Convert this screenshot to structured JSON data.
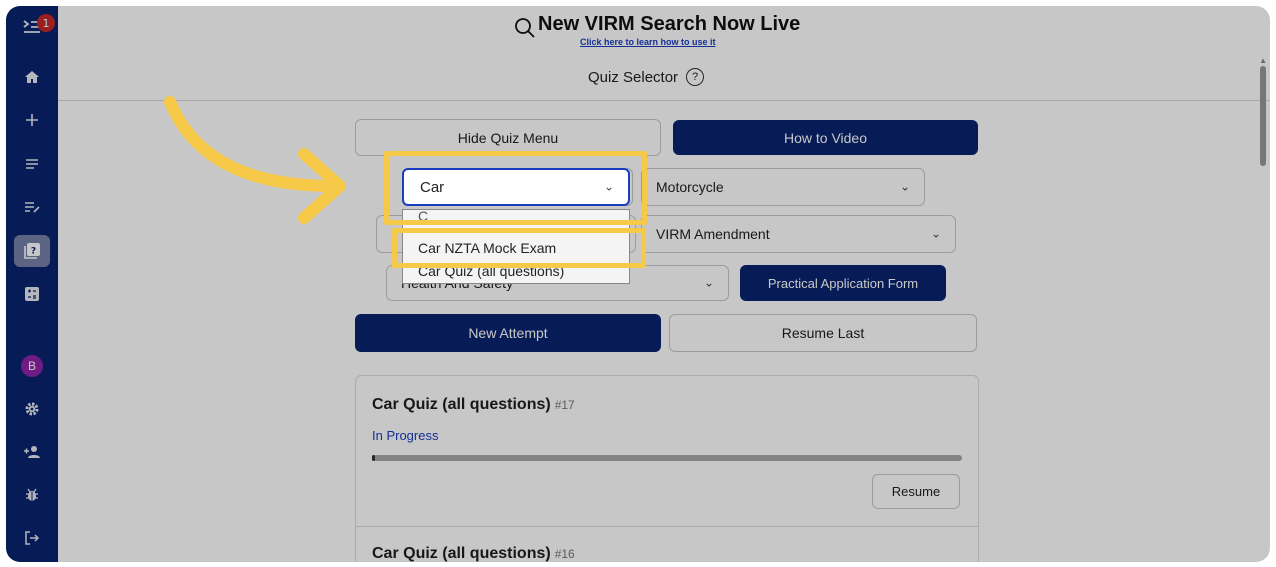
{
  "sidebar": {
    "badge_count": "1",
    "avatar_letter": "B",
    "items": [
      {
        "icon": "menu-collapse-icon"
      },
      {
        "icon": "home-icon"
      },
      {
        "icon": "plus-icon"
      },
      {
        "icon": "list-icon"
      },
      {
        "icon": "edit-list-icon"
      },
      {
        "icon": "quiz-icon"
      },
      {
        "icon": "calculator-icon"
      },
      {
        "icon": "avatar-icon"
      },
      {
        "icon": "gear-icon"
      },
      {
        "icon": "add-user-icon"
      },
      {
        "icon": "bug-icon"
      },
      {
        "icon": "logout-icon"
      }
    ]
  },
  "banner": {
    "title": "New VIRM Search Now Live",
    "link": "Click here to learn how to use it"
  },
  "quiz_selector": {
    "title": "Quiz Selector",
    "help_glyph": "?"
  },
  "buttons": {
    "hide_menu": "Hide Quiz Menu",
    "how_to": "How to Video",
    "practical_form": "Practical Application Form",
    "new_attempt": "New Attempt",
    "resume_last": "Resume Last",
    "resume": "Resume"
  },
  "selects": {
    "vehicle": "Car",
    "category": "Motorcycle",
    "left_row2": "",
    "amendment": "VIRM Amendment",
    "left_row3": "Health And Safety"
  },
  "dropdown": {
    "partial": "C",
    "options": [
      "Car NZTA Mock Exam",
      "Car Quiz (all questions)"
    ]
  },
  "attempts": [
    {
      "title": "Car Quiz (all questions)",
      "number": "#17",
      "status": "In Progress",
      "progress": 0.005
    },
    {
      "title": "Car Quiz (all questions)",
      "number": "#16"
    }
  ],
  "colors": {
    "navy": "#0a2570",
    "highlight": "#f7c948",
    "link": "#1a3dbf"
  }
}
